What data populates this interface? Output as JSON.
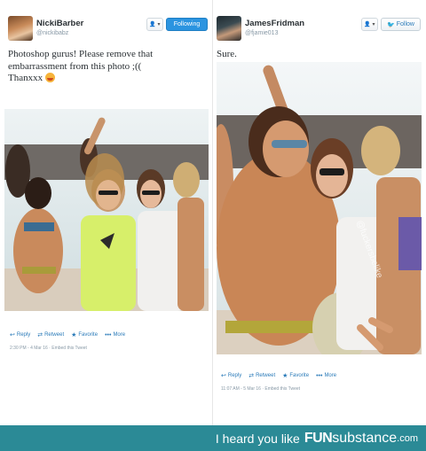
{
  "tweets": [
    {
      "display_name": "NickiBarber",
      "handle": "@nickibabz",
      "avatar_icon": "user-avatar-photo",
      "menu_label": "👤 ▾",
      "follow_label": "Following",
      "text_lines": [
        "Photoshop gurus! Please remove that",
        "embarrassment from this photo ;((",
        "Thanxxx"
      ],
      "emoji_icon": "face-emoji",
      "actions": {
        "reply": "Reply",
        "retweet": "Retweet",
        "favorite": "Favorite",
        "more": "More"
      },
      "meta": "2:30 PM - 4 Mar 16 · Embed this Tweet"
    },
    {
      "display_name": "JamesFridman",
      "handle": "@fjamie013",
      "avatar_icon": "user-avatar-photo",
      "menu_label": "👤 ▾",
      "follow_label": "Follow",
      "text_lines": [
        "Sure."
      ],
      "actions": {
        "reply": "Reply",
        "retweet": "Retweet",
        "favorite": "Favorite",
        "more": "More"
      },
      "meta": "11:07 AM - 5 Mar 16 · Embed this Tweet"
    }
  ],
  "photo_watermark": "@fuckersbelike",
  "footer": {
    "prefix": "I heard you like",
    "brand_fun": "FUN",
    "brand_sub": "substance",
    "brand_tld": ".com"
  },
  "colors": {
    "follow_blue": "#2b94e0",
    "link_blue": "#2b7bb9",
    "footer_teal": "#2b8a96",
    "muted": "#8899a6"
  }
}
